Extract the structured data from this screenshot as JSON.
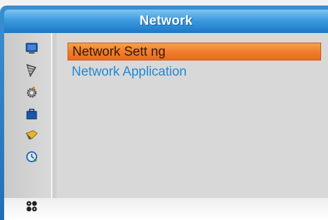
{
  "title": "Network",
  "menu": {
    "items": [
      {
        "label": "Network Sett ng",
        "selected": true
      },
      {
        "label": "Network Application",
        "selected": false
      }
    ]
  },
  "sidebar": {
    "icons": [
      "tv-icon",
      "satellite-dish-icon",
      "settings-gear-icon",
      "toolbox-icon",
      "network-icon",
      "clock-icon",
      "games-icon"
    ]
  },
  "colors": {
    "selected_bg": "#ef7e2e",
    "normal_text": "#1e88d6",
    "title_bar": "#3d9be0"
  }
}
